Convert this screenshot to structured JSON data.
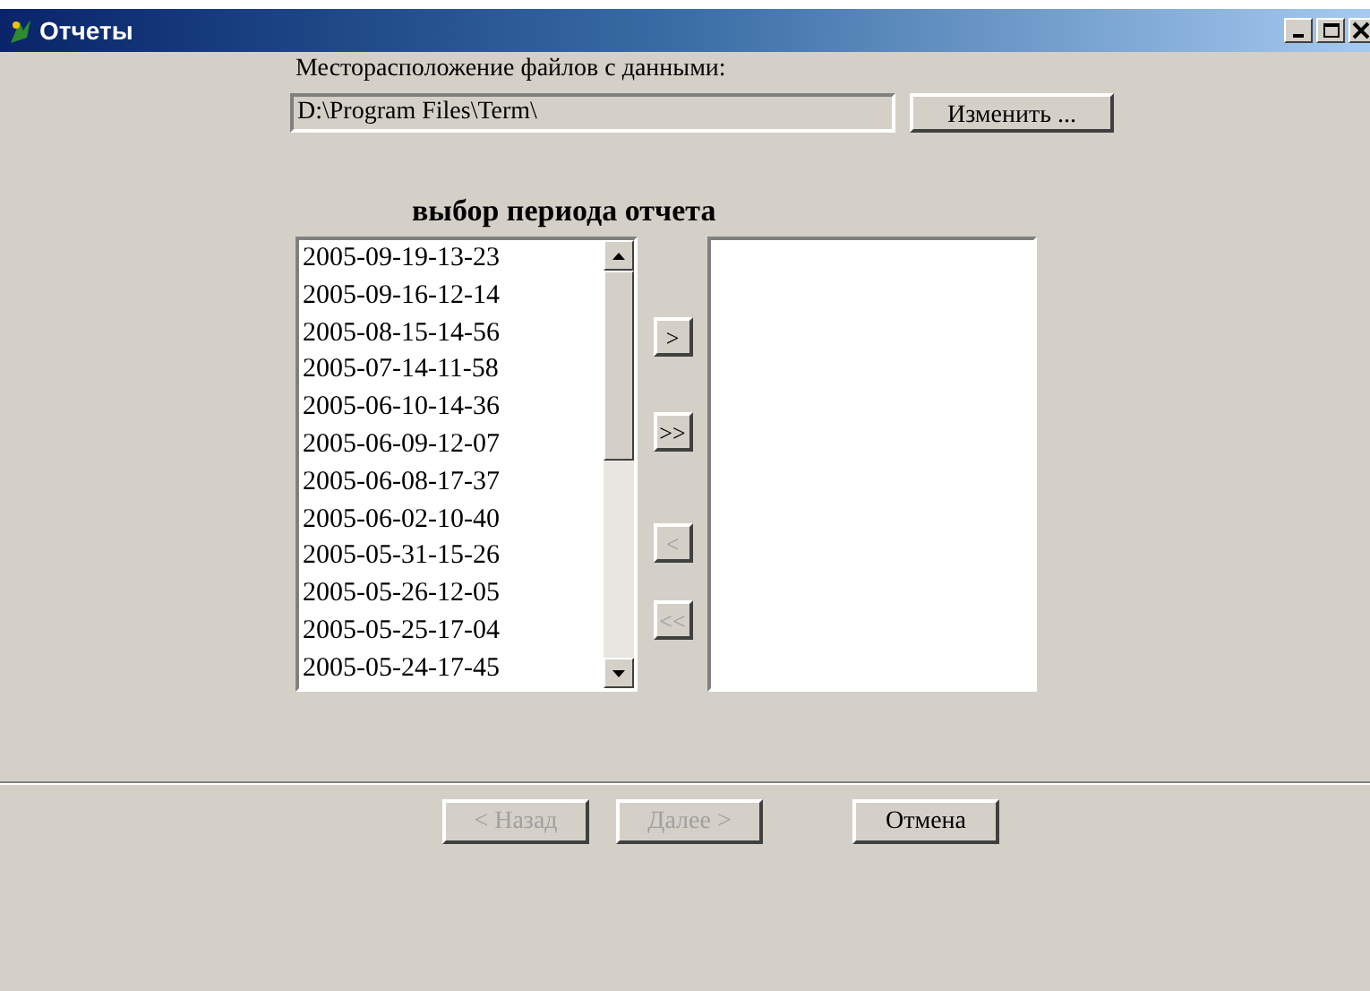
{
  "window": {
    "title": "Отчеты"
  },
  "location_label": "Месторасположение файлов с данными:",
  "location_field": {
    "value": "D:\\Program Files\\Term\\"
  },
  "change_button": {
    "label": "Изменить ...",
    "disabled": false
  },
  "period_heading": "выбор периода отчета",
  "available_list": [
    {
      "label": "2005-09-19-13-23",
      "selected": false
    },
    {
      "label": "2005-09-16-12-14",
      "selected": false
    },
    {
      "label": "2005-08-15-14-56",
      "selected": false
    },
    {
      "label": "2005-07-14-11-58",
      "selected": false
    },
    {
      "label": "2005-06-10-14-36",
      "selected": false
    },
    {
      "label": "2005-06-09-12-07",
      "selected": false
    },
    {
      "label": "2005-06-08-17-37",
      "selected": false
    },
    {
      "label": "2005-06-02-10-40",
      "selected": false
    },
    {
      "label": "2005-05-31-15-26",
      "selected": false
    },
    {
      "label": "2005-05-26-12-05",
      "selected": false
    },
    {
      "label": "2005-05-25-17-04",
      "selected": false
    },
    {
      "label": "2005-05-24-17-45",
      "selected": false
    }
  ],
  "move_buttons": [
    {
      "label": ">",
      "disabled": false
    },
    {
      "label": ">>",
      "disabled": false
    },
    {
      "label": "<",
      "disabled": true
    },
    {
      "label": "<<",
      "disabled": true
    }
  ],
  "footer_buttons": [
    {
      "label": "< Назад",
      "disabled": true
    },
    {
      "label": "Далее >",
      "disabled": true
    },
    {
      "label": "Отмена",
      "disabled": false
    }
  ]
}
